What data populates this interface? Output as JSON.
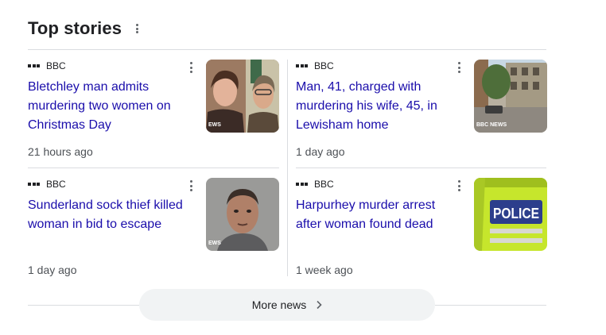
{
  "section": {
    "title": "Top stories"
  },
  "stories": [
    {
      "source": "BBC",
      "headline": "Bletchley man admits murdering two women on Christmas Day",
      "age": "21 hours ago",
      "thumb_icon": "news-thumbnail-two-women-photo"
    },
    {
      "source": "BBC",
      "headline": "Man, 41, charged with murdering his wife, 45, in Lewisham home",
      "age": "1 day ago",
      "thumb_icon": "news-thumbnail-street-buildings-photo"
    },
    {
      "source": "BBC",
      "headline": "Sunderland sock thief killed woman in bid to escape",
      "age": "1 day ago",
      "thumb_icon": "news-thumbnail-mugshot-photo"
    },
    {
      "source": "BBC",
      "headline": "Harpurhey murder arrest after woman found dead",
      "age": "1 week ago",
      "thumb_icon": "news-thumbnail-police-jacket-photo"
    }
  ],
  "more": {
    "label": "More news"
  },
  "colors": {
    "link": "#1a0dab",
    "divider": "#dadce0",
    "button_bg": "#f1f3f4",
    "muted_text": "#4d5156"
  }
}
